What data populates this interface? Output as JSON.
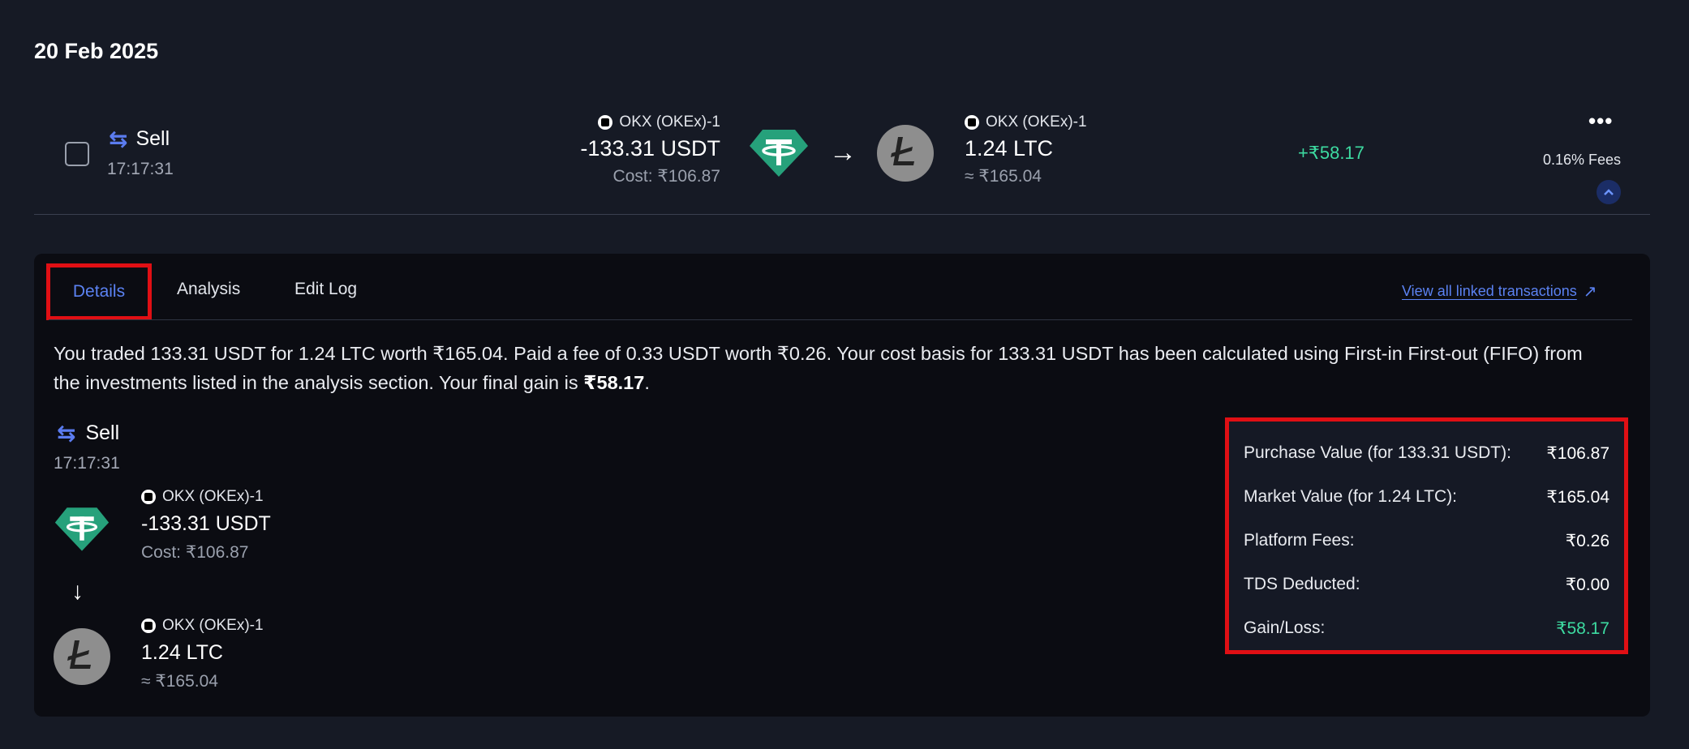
{
  "date_heading": "20 Feb 2025",
  "transaction": {
    "type_label": "Sell",
    "time": "17:17:31",
    "from": {
      "exchange": "OKX (OKEx)-1",
      "amount": "-133.31 USDT",
      "cost": "Cost: ₹106.87",
      "coin_icon": "tether-icon"
    },
    "to": {
      "exchange": "OKX (OKEx)-1",
      "amount": "1.24 LTC",
      "value": "≈ ₹165.04",
      "coin_icon": "litecoin-icon"
    },
    "gain": "+₹58.17",
    "fees": "0.16% Fees"
  },
  "tabs": [
    {
      "label": "Details",
      "active": true
    },
    {
      "label": "Analysis",
      "active": false
    },
    {
      "label": "Edit Log",
      "active": false
    }
  ],
  "view_linked_label": "View all linked transactions",
  "summary": {
    "text": "You traded 133.31 USDT for 1.24 LTC worth ₹165.04. Paid a fee of 0.33 USDT worth ₹0.26. Your cost basis for 133.31 USDT has been calculated using First-in First-out (FIFO) from the investments listed in the analysis section. Your final gain is ",
    "gain_bold": "₹58.17",
    "end": "."
  },
  "details": {
    "type_label": "Sell",
    "time": "17:17:31",
    "from": {
      "exchange": "OKX (OKEx)-1",
      "amount": "-133.31 USDT",
      "cost": "Cost: ₹106.87"
    },
    "to": {
      "exchange": "OKX (OKEx)-1",
      "amount": "1.24 LTC",
      "value": "≈ ₹165.04"
    }
  },
  "values": [
    {
      "label": "Purchase Value (for 133.31 USDT):",
      "value": "₹106.87"
    },
    {
      "label": "Market Value (for 1.24 LTC):",
      "value": "₹165.04"
    },
    {
      "label": "Platform Fees:",
      "value": "₹0.26"
    },
    {
      "label": "TDS Deducted:",
      "value": "₹0.00"
    },
    {
      "label": "Gain/Loss:",
      "value": "₹58.17"
    }
  ],
  "colors": {
    "background": "#161a25",
    "panel": "#0b0c12",
    "accent": "#5b82f2",
    "gain": "#3ddba1",
    "highlight": "#e00f14",
    "tether": "#26a17b",
    "litecoin": "#8e8e8e"
  }
}
